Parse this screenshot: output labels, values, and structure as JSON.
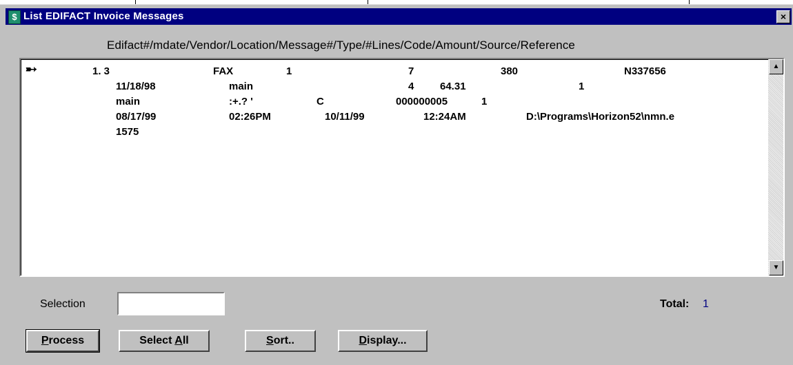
{
  "window": {
    "title": "List EDIFACT Invoice Messages",
    "icon_glyph": "$",
    "close_glyph": "×"
  },
  "columns_header": "Edifact#/mdate/Vendor/Location/Message#/Type/#Lines/Code/Amount/Source/Reference",
  "list": {
    "row_marker_glyph": "➸",
    "lines": [
      [
        "1. 3",
        "FAX",
        "1",
        "7",
        "380",
        "N337656"
      ],
      [
        "11/18/98",
        "main",
        "4",
        "64.31",
        "1"
      ],
      [
        "main",
        ":+.? '",
        "C",
        "000000005",
        "1"
      ],
      [
        "08/17/99",
        "02:26PM",
        "10/11/99",
        "12:24AM",
        "D:\\Programs\\Horizon52\\nmn.e"
      ],
      [
        "1575"
      ]
    ]
  },
  "scrollbar": {
    "up_glyph": "▲",
    "down_glyph": "▼"
  },
  "selection": {
    "label": "Selection",
    "value": ""
  },
  "total": {
    "label": "Total:",
    "value": "1",
    "value_color": "#000080"
  },
  "buttons": {
    "process": {
      "accel": "P",
      "rest": "rocess"
    },
    "select_all": {
      "before": "Select ",
      "accel": "A",
      "rest": "ll"
    },
    "sort": {
      "accel": "S",
      "rest": "ort.."
    },
    "display": {
      "accel": "D",
      "rest": "isplay..."
    }
  }
}
